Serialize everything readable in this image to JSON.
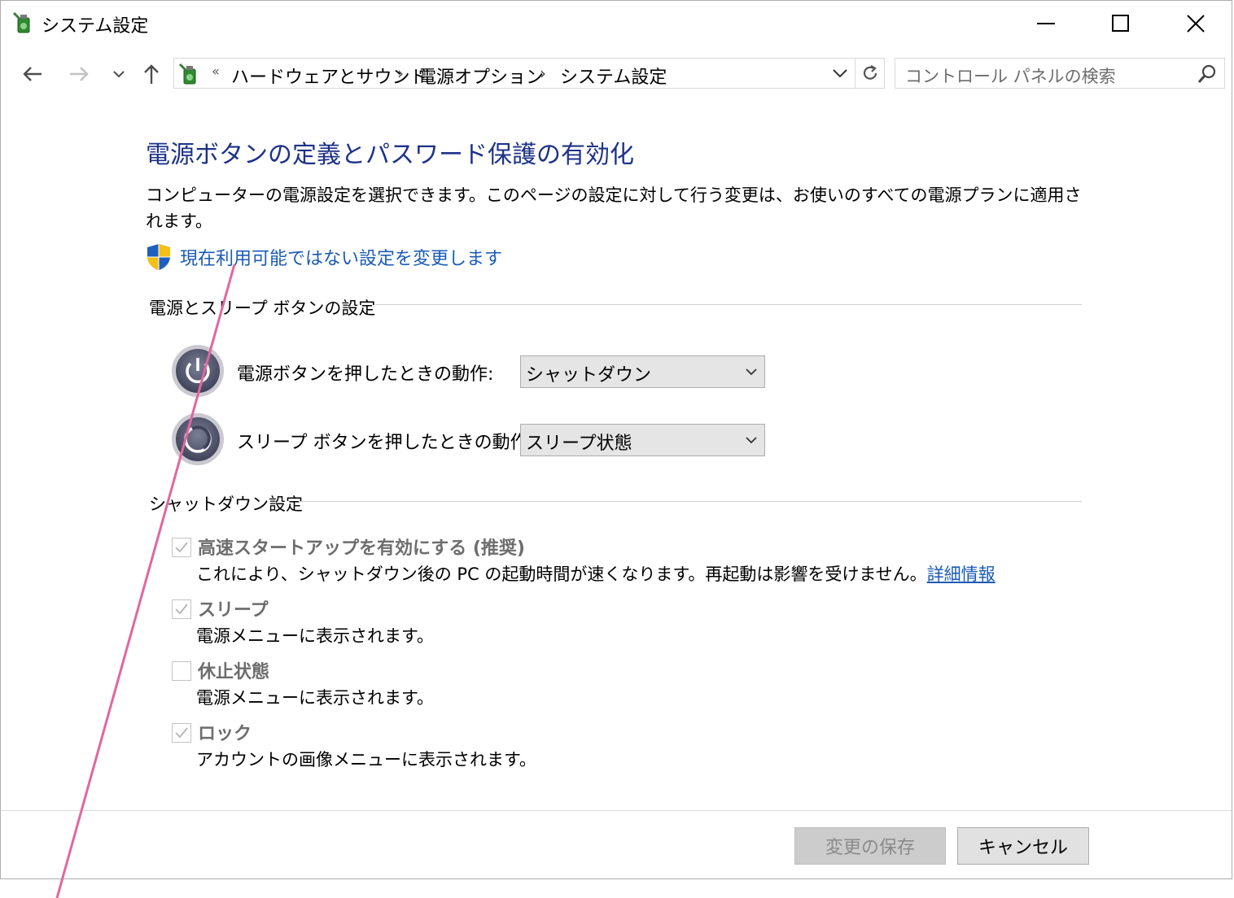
{
  "window": {
    "title": "システム設定"
  },
  "nav": {
    "breadcrumb_prefix": "«",
    "breadcrumbs": [
      "ハードウェアとサウンド",
      "電源オプション",
      "システム設定"
    ],
    "breadcrumb_separator": "›",
    "search_placeholder": "コントロール パネルの検索"
  },
  "page": {
    "title": "電源ボタンの定義とパスワード保護の有効化",
    "description": "コンピューターの電源設定を選択できます。このページの設定に対して行う変更は、お使いのすべての電源プランに適用されます。",
    "change_link": "現在利用可能ではない設定を変更します"
  },
  "power_section": {
    "header": "電源とスリープ ボタンの設定",
    "rows": [
      {
        "label": "電源ボタンを押したときの動作:",
        "value": "シャットダウン"
      },
      {
        "label": "スリープ ボタンを押したときの動作:",
        "value": "スリープ状態"
      }
    ]
  },
  "shutdown_section": {
    "header": "シャットダウン設定",
    "options": [
      {
        "label": "高速スタートアップを有効にする (推奨)",
        "checked": true,
        "description": "これにより、シャットダウン後の PC の起動時間が速くなります。再起動は影響を受けません。",
        "link": "詳細情報"
      },
      {
        "label": "スリープ",
        "checked": true,
        "description": "電源メニューに表示されます。"
      },
      {
        "label": "休止状態",
        "checked": false,
        "description": "電源メニューに表示されます。"
      },
      {
        "label": "ロック",
        "checked": true,
        "description": "アカウントの画像メニューに表示されます。"
      }
    ]
  },
  "footer": {
    "save_label": "変更の保存",
    "cancel_label": "キャンセル"
  },
  "colors": {
    "title_blue": "#1e3287",
    "link_blue": "#1a5bb5",
    "annotation_pink": "#e0679f"
  }
}
